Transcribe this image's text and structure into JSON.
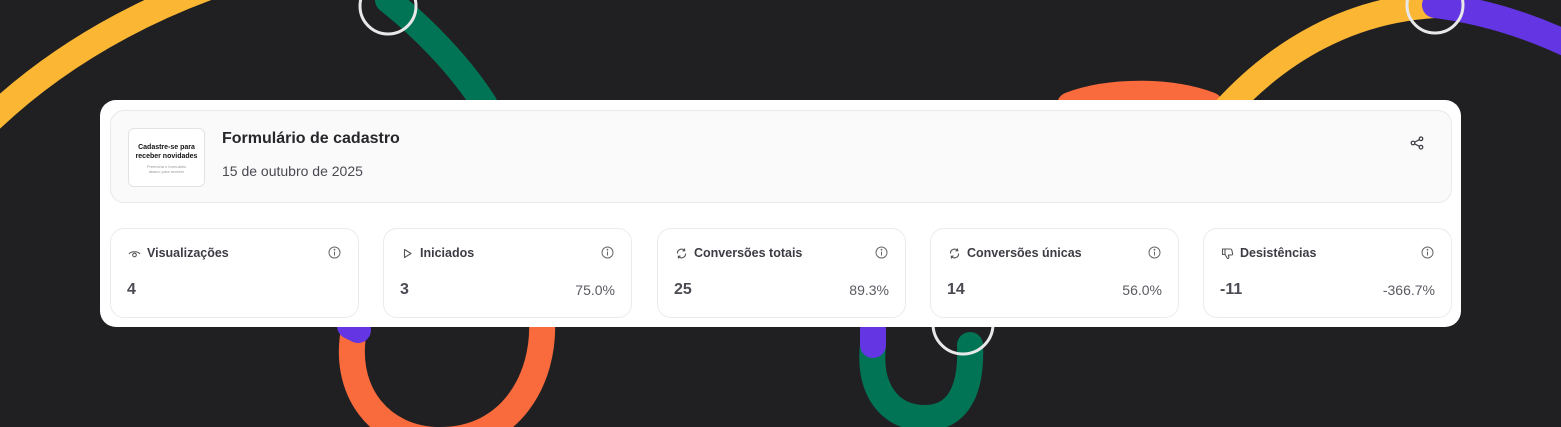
{
  "form": {
    "title": "Formulário de cadastro",
    "date": "15 de outubro de 2025",
    "thumbnail": {
      "heading": "Cadastre-se para receber novidades",
      "body": "Preencha o formulário abaixo para receber"
    }
  },
  "metrics": [
    {
      "label": "Visualizações",
      "icon": "eye-icon",
      "value": "4",
      "percent": ""
    },
    {
      "label": "Iniciados",
      "icon": "play-icon",
      "value": "3",
      "percent": "75.0%"
    },
    {
      "label": "Conversões totais",
      "icon": "refresh-icon",
      "value": "25",
      "percent": "89.3%"
    },
    {
      "label": "Conversões únicas",
      "icon": "refresh-icon",
      "value": "14",
      "percent": "56.0%"
    },
    {
      "label": "Desistências",
      "icon": "thumbs-down-icon",
      "value": "-11",
      "percent": "-366.7%"
    }
  ],
  "colors": {
    "background": "#202022",
    "yellow": "#fbb733",
    "green": "#017456",
    "orange": "#f96a3c",
    "purple": "#6335e3"
  }
}
